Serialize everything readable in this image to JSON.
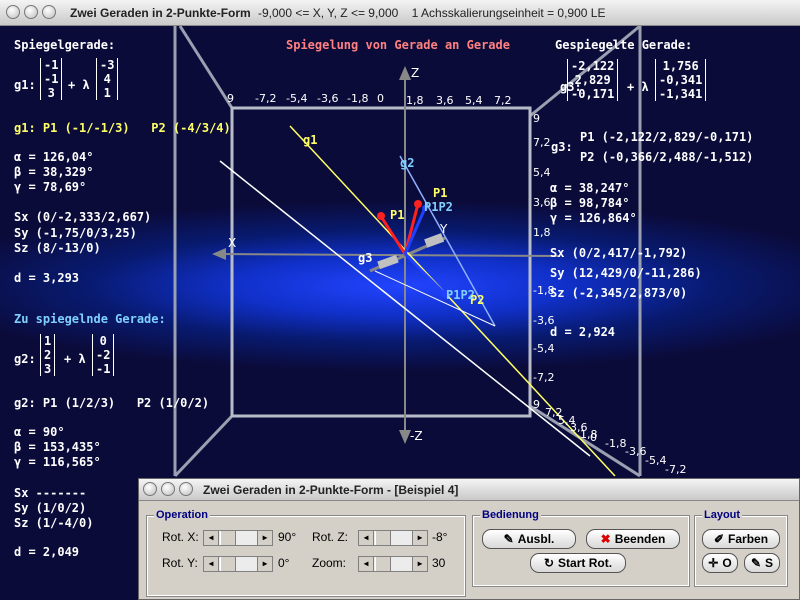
{
  "window": {
    "title": "Zwei Geraden in 2-Punkte-Form",
    "info": "-9,000 <= X, Y, Z <= 9,000    1 Achsskalierungseinheit = 0,900 LE"
  },
  "header": {
    "center": "Spiegelung von Gerade an Gerade",
    "left": "Spiegelgerade:",
    "right": "Gespiegelte Gerade:"
  },
  "left_panel": {
    "g1_name": "g1:",
    "g1_p": [
      "-1",
      "-1",
      "3"
    ],
    "g1_d": [
      "-3",
      "4",
      "1"
    ],
    "plus_lambda": "+ λ",
    "g1_points": "g1: P1 (-1/-1/3)   P2 (-4/3/4)",
    "g1_alpha": "α = 126,04°",
    "g1_beta": "β = 38,329°",
    "g1_gamma": "γ = 78,69°",
    "sx": "Sx (0/-2,333/2,667)",
    "sy": "Sy (-1,75/0/3,25)",
    "sz": "Sz (8/-13/0)",
    "d1": "d = 3,293",
    "zu_spiegeln": "Zu spiegelnde Gerade:",
    "g2_name": "g2:",
    "g2_p": [
      "1",
      "2",
      "3"
    ],
    "g2_d": [
      "0",
      "-2",
      "-1"
    ],
    "g2_points": "g2: P1 (1/2/3)   P2 (1/0/2)",
    "g2_alpha": "α = 90°",
    "g2_beta": "β = 153,435°",
    "g2_gamma": "γ = 116,565°",
    "sx2": "Sx -------",
    "sy2": "Sy (1/0/2)",
    "sz2": "Sz (1/-4/0)",
    "d2": "d = 2,049"
  },
  "right_panel": {
    "g3_name": "g3:",
    "g3_p": [
      "-2,122",
      "2,829",
      "-0,171"
    ],
    "g3_d": [
      "1,756",
      "-0,341",
      "-1,341"
    ],
    "plus_lambda": "+ λ",
    "g3_label": "g3:",
    "p1": "P1 (-2,122/2,829/-0,171)",
    "p2": "P2 (-0,366/2,488/-1,512)",
    "alpha": "α = 38,247°",
    "beta": "β = 98,784°",
    "gamma": "γ = 126,864°",
    "sx": "Sx (0/2,417/-1,792)",
    "sy": "Sy (12,429/0/-11,286)",
    "sz": "Sz (-2,345/2,873/0)",
    "d": "d = 2,924"
  },
  "axes": {
    "z": "Z",
    "minus_z": "-Z",
    "x": "X",
    "y": "Y",
    "top_ticks": [
      "9",
      "-7,2",
      "-5,4",
      "-3,6",
      "-1,8",
      "0",
      "1,8",
      "3,6",
      "5,4",
      "7,2",
      "9"
    ],
    "right_ticks": [
      "9",
      "7,2",
      "5,4",
      "3,6",
      "1,8",
      "-1,8",
      "-3,6",
      "-5,4",
      "-7,2"
    ],
    "bottom_ticks": [
      "9",
      "7,2",
      "5,4",
      "3,6",
      "1,8",
      "0",
      "-1,8",
      "-3,6",
      "-5,4",
      "-7,2"
    ]
  },
  "labels3d": {
    "g1": "g1",
    "g2": "g2",
    "g3": "g3",
    "p1": "P1",
    "p2": "P2",
    "p1p2": "P1P2",
    "p1_blue": "P1P2"
  },
  "dialog": {
    "title": "Zwei Geraden in 2-Punkte-Form - [Beispiel 4]",
    "operation": "Operation",
    "rot_x": "Rot. X:",
    "rot_x_val": "90°",
    "rot_y": "Rot. Y:",
    "rot_y_val": "0°",
    "rot_z": "Rot. Z:",
    "rot_z_val": "-8°",
    "zoom": "Zoom:",
    "zoom_val": "30",
    "bedienung": "Bedienung",
    "ausbl": "Ausbl.",
    "beenden": "Beenden",
    "start_rot": "Start Rot.",
    "layout": "Layout",
    "farben": "Farben",
    "o": "O",
    "s": "S"
  },
  "colors": {
    "g1": "#ffff66",
    "g3": "#ffffff",
    "g2": "#6699ff",
    "point_red": "#ff2020",
    "background": "#0b0b3a"
  }
}
